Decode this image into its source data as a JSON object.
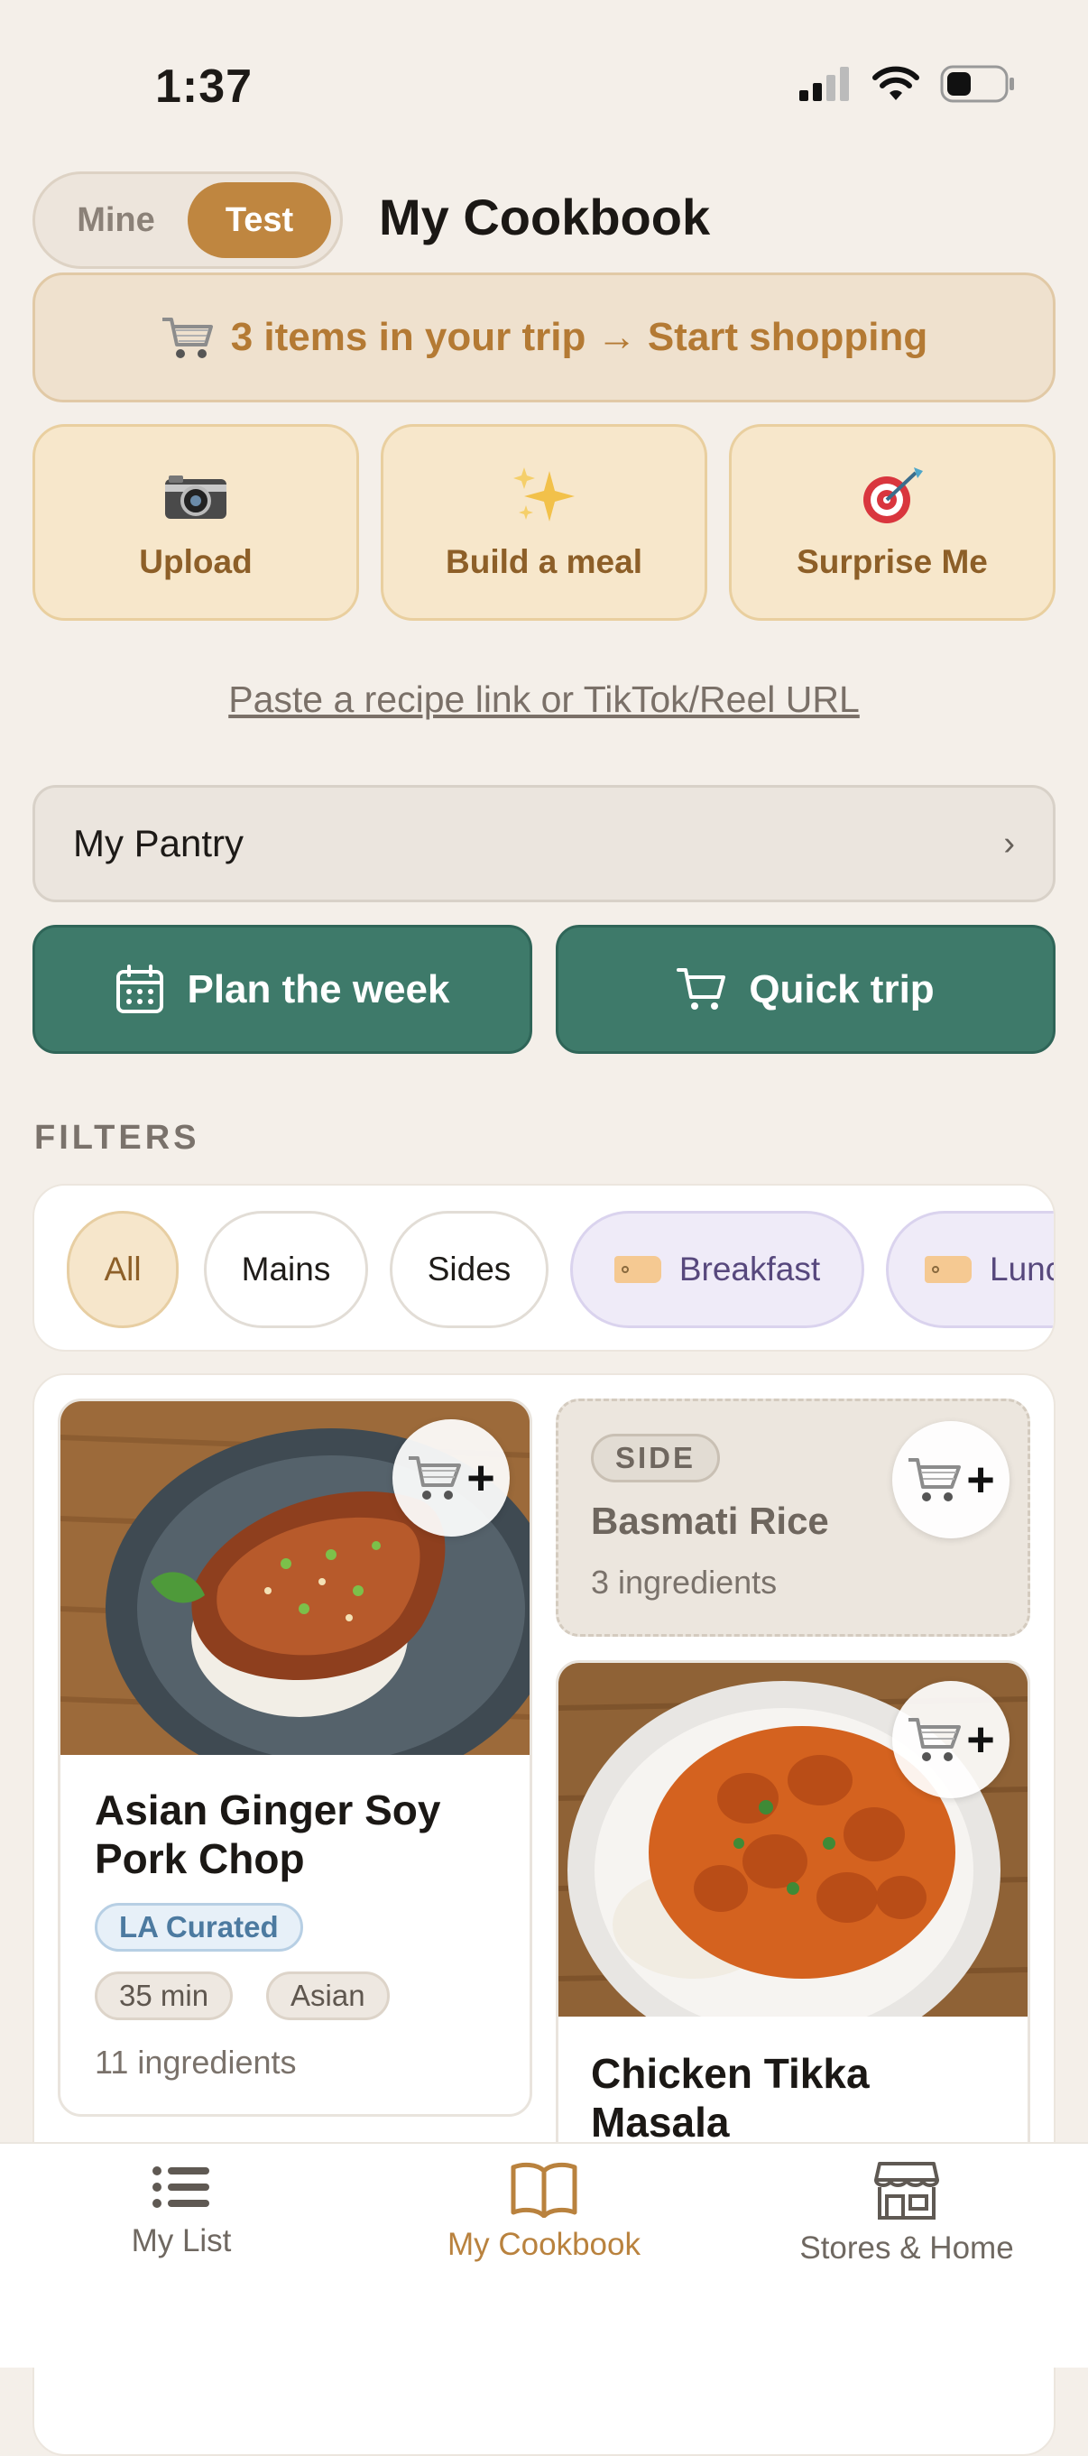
{
  "status_bar": {
    "time": "1:37"
  },
  "header": {
    "segment": {
      "options": [
        "Mine",
        "Test"
      ],
      "selected": "Test"
    },
    "title": "My Cookbook"
  },
  "trip_banner": {
    "icon": "cart-icon",
    "text": "3 items in your trip → Start shopping"
  },
  "actions": [
    {
      "label": "Upload",
      "icon": "camera-icon"
    },
    {
      "label": "Build a meal",
      "icon": "sparkles-icon"
    },
    {
      "label": "Surprise Me",
      "icon": "target-icon"
    }
  ],
  "paste_link": "Paste a recipe link or TikTok/Reel URL",
  "pantry": {
    "label": "My Pantry",
    "chevron": "›"
  },
  "primary_buttons": [
    {
      "label": "Plan the week",
      "icon": "calendar-icon"
    },
    {
      "label": "Quick trip",
      "icon": "cart-outline-icon"
    }
  ],
  "filters": {
    "heading": "FILTERS",
    "chips": [
      {
        "label": "All",
        "selected": true
      },
      {
        "label": "Mains"
      },
      {
        "label": "Sides"
      },
      {
        "label": "Breakfast",
        "tag": true
      },
      {
        "label": "Lunch",
        "tag": true
      }
    ]
  },
  "recipes": [
    {
      "title_line1": "Asian Ginger Soy",
      "title_line2": "Pork Chop",
      "badge": "LA Curated",
      "time": "35 min",
      "cuisine": "Asian",
      "ingredients": "11 ingredients"
    },
    {
      "tag": "SIDE",
      "title": "Basmati Rice",
      "ingredients": "3 ingredients"
    },
    {
      "title_line1": "Chicken Tikka",
      "title_line2": "Masala"
    }
  ],
  "tabbar": {
    "tabs": [
      {
        "label": "My List",
        "icon": "list-icon"
      },
      {
        "label": "My Cookbook",
        "icon": "book-icon",
        "active": true
      },
      {
        "label": "Stores & Home",
        "icon": "store-icon"
      }
    ]
  },
  "colors": {
    "accent": "#bf8640",
    "green": "#3e7a6a",
    "background": "#f4efe9"
  }
}
